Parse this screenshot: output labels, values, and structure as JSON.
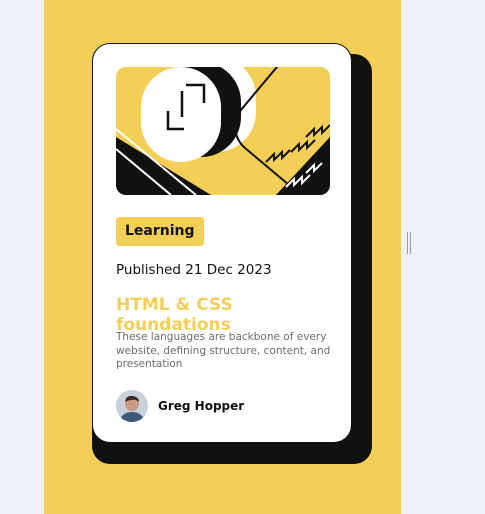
{
  "card": {
    "image_alt": "Abstract illustration",
    "tag": "Learning",
    "published": "Published 21 Dec 2023",
    "title": "HTML & CSS foundations",
    "description": "These languages are backbone of every website, defining structure, content, and presentation",
    "author": {
      "name": "Greg Hopper",
      "avatar_icon": "person-avatar"
    }
  },
  "colors": {
    "accent_yellow": "#f4cf57",
    "ink": "#111111",
    "muted_text": "#6b6b6b",
    "card_bg": "#ffffff",
    "page_bg": "#eef1fa"
  }
}
